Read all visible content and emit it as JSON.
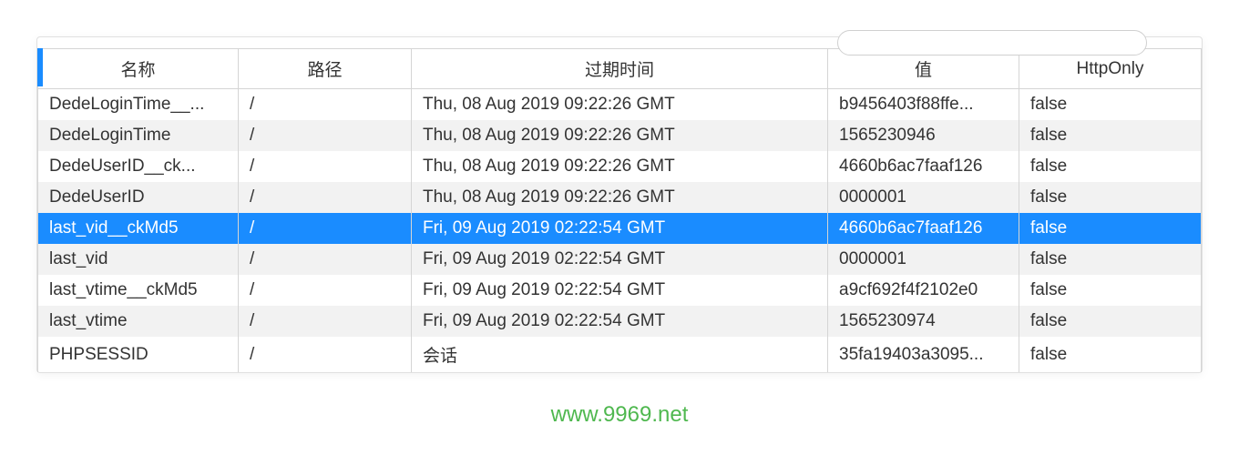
{
  "table": {
    "headers": {
      "name": "名称",
      "path": "路径",
      "expires": "过期时间",
      "value": "值",
      "httponly": "HttpOnly"
    },
    "rows": [
      {
        "name": "DedeLoginTime__...",
        "path": "/",
        "expires": "Thu, 08 Aug 2019 09:22:26 GMT",
        "value": "b9456403f88ffe...",
        "httponly": "false",
        "selected": false
      },
      {
        "name": "DedeLoginTime",
        "path": "/",
        "expires": "Thu, 08 Aug 2019 09:22:26 GMT",
        "value": "1565230946",
        "httponly": "false",
        "selected": false
      },
      {
        "name": "DedeUserID__ck...",
        "path": "/",
        "expires": "Thu, 08 Aug 2019 09:22:26 GMT",
        "value": "4660b6ac7faaf126",
        "httponly": "false",
        "selected": false
      },
      {
        "name": "DedeUserID",
        "path": "/",
        "expires": "Thu, 08 Aug 2019 09:22:26 GMT",
        "value": "0000001",
        "httponly": "false",
        "selected": false
      },
      {
        "name": "last_vid__ckMd5",
        "path": "/",
        "expires": "Fri, 09 Aug 2019 02:22:54 GMT",
        "value": "4660b6ac7faaf126",
        "httponly": "false",
        "selected": true
      },
      {
        "name": "last_vid",
        "path": "/",
        "expires": "Fri, 09 Aug 2019 02:22:54 GMT",
        "value": "0000001",
        "httponly": "false",
        "selected": false
      },
      {
        "name": "last_vtime__ckMd5",
        "path": "/",
        "expires": "Fri, 09 Aug 2019 02:22:54 GMT",
        "value": "a9cf692f4f2102e0",
        "httponly": "false",
        "selected": false
      },
      {
        "name": "last_vtime",
        "path": "/",
        "expires": "Fri, 09 Aug 2019 02:22:54 GMT",
        "value": "1565230974",
        "httponly": "false",
        "selected": false
      },
      {
        "name": "PHPSESSID",
        "path": "/",
        "expires": "会话",
        "value": "35fa19403a3095...",
        "httponly": "false",
        "selected": false
      }
    ]
  },
  "watermark": "www.9969.net"
}
